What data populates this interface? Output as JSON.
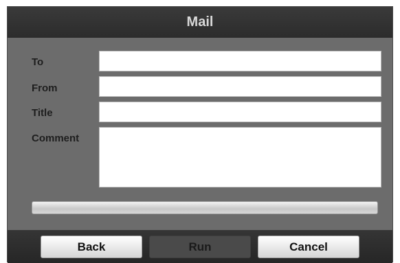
{
  "window": {
    "title": "Mail"
  },
  "form": {
    "to": {
      "label": "To",
      "value": "",
      "placeholder": ""
    },
    "from": {
      "label": "From",
      "value": "",
      "placeholder": ""
    },
    "title": {
      "label": "Title",
      "value": "",
      "placeholder": ""
    },
    "comment": {
      "label": "Comment",
      "value": "",
      "placeholder": ""
    }
  },
  "progress": {
    "fraction": 0
  },
  "buttons": {
    "back_label": "Back",
    "run_label": "Run",
    "cancel_label": "Cancel"
  },
  "colors": {
    "panel": "#6c6c6c",
    "title_bar": "#2c2c2c",
    "title_text": "#d9d9d9"
  }
}
